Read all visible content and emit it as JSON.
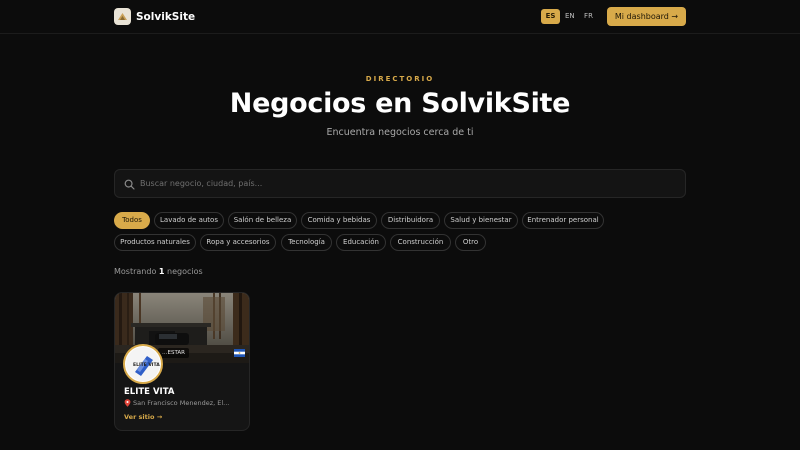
{
  "header": {
    "brand": "SolvikSite",
    "languages": [
      {
        "code": "ES",
        "active": true
      },
      {
        "code": "EN",
        "active": false
      },
      {
        "code": "FR",
        "active": false
      }
    ],
    "dashboard_button": "Mi dashboard →"
  },
  "hero": {
    "eyebrow": "DIRECTORIO",
    "title": "Negocios en SolvikSite",
    "subtitle": "Encuentra negocios cerca de ti"
  },
  "search": {
    "placeholder": "Buscar negocio, ciudad, país...",
    "value": ""
  },
  "categories": [
    {
      "label": "Todos",
      "active": true
    },
    {
      "label": "Lavado de autos",
      "active": false
    },
    {
      "label": "Salón de belleza",
      "active": false
    },
    {
      "label": "Comida y bebidas",
      "active": false
    },
    {
      "label": "Distribuidora",
      "active": false
    },
    {
      "label": "Salud y bienestar",
      "active": false
    },
    {
      "label": "Entrenador personal",
      "active": false
    },
    {
      "label": "Productos naturales",
      "active": false
    },
    {
      "label": "Ropa y accesorios",
      "active": false
    },
    {
      "label": "Tecnología",
      "active": false
    },
    {
      "label": "Educación",
      "active": false
    },
    {
      "label": "Construcción",
      "active": false
    },
    {
      "label": "Otro",
      "active": false
    }
  ],
  "results": {
    "prefix": "Mostrando",
    "count": "1",
    "suffix": "negocios"
  },
  "business_card": {
    "badge": "…ESTAR",
    "avatar_text": "ELITE VITA",
    "name": "ELITE VITA",
    "location": "San Francisco Menendez, El...",
    "link": "Ver sitio →"
  },
  "colors": {
    "accent": "#d8aa4a",
    "background": "#0c0c0c",
    "card": "#151515"
  },
  "icons": {
    "search": "search-icon",
    "location": "pin-icon",
    "country_flag": "flag-icon"
  }
}
